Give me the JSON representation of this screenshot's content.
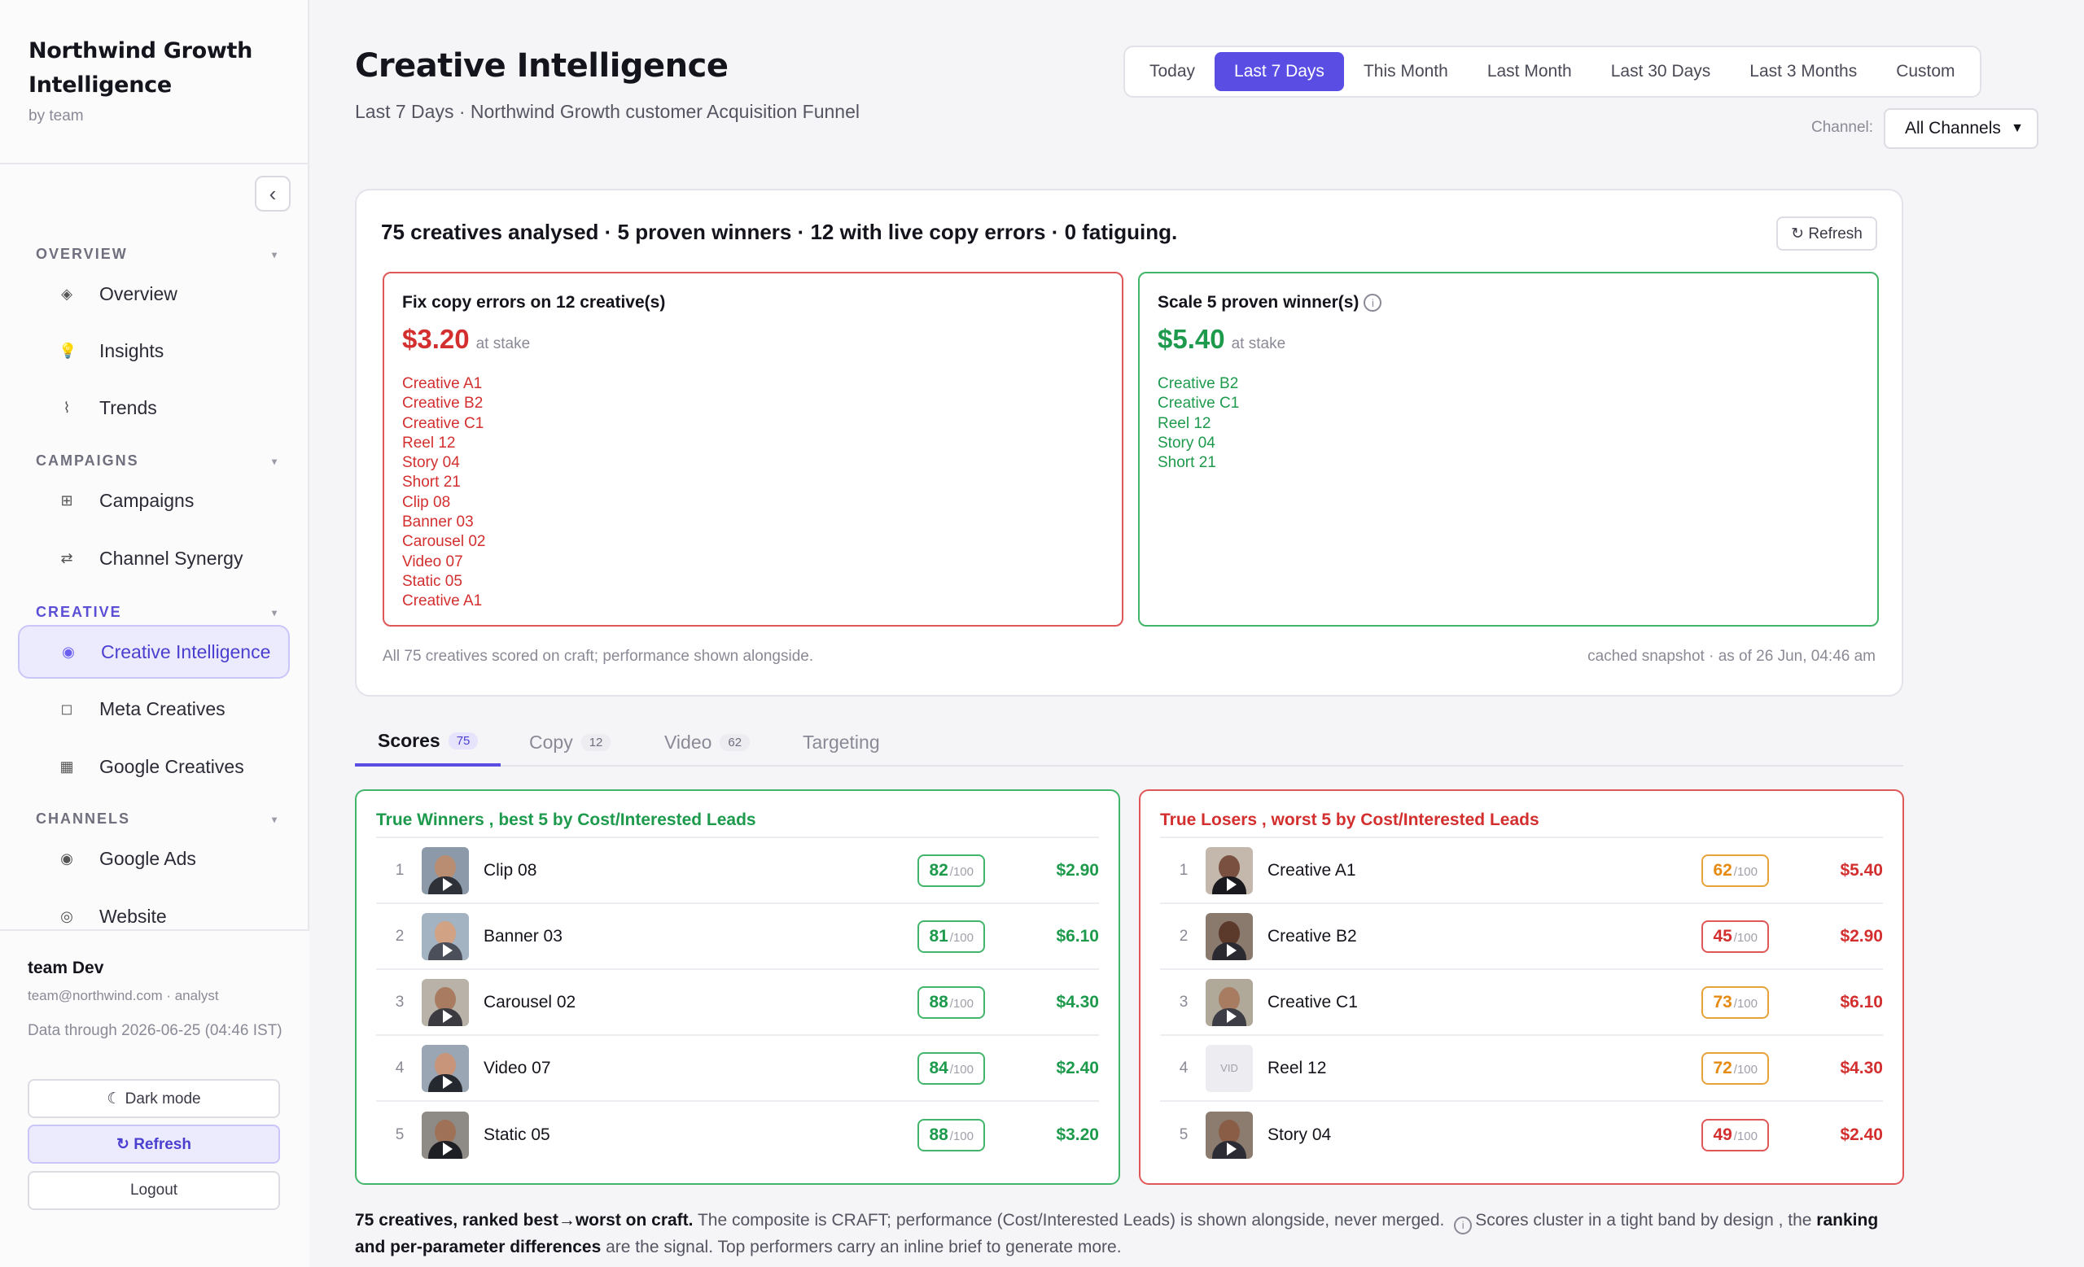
{
  "brand": {
    "title": "Northwind Growth Intelligence",
    "subtitle": "by team"
  },
  "sidebar": {
    "sections": [
      {
        "label": "OVERVIEW"
      },
      {
        "label": "CAMPAIGNS"
      },
      {
        "label": "CREATIVE"
      },
      {
        "label": "CHANNELS"
      }
    ],
    "items": [
      {
        "label": "Overview",
        "icon": "◈"
      },
      {
        "label": "Insights",
        "icon": "💡"
      },
      {
        "label": "Trends",
        "icon": "⌇"
      },
      {
        "label": "Campaigns",
        "icon": "⊞"
      },
      {
        "label": "Channel Synergy",
        "icon": "⇄"
      },
      {
        "label": "Creative Intelligence",
        "icon": "◉"
      },
      {
        "label": "Meta Creatives",
        "icon": "◻"
      },
      {
        "label": "Google Creatives",
        "icon": "▦"
      },
      {
        "label": "Google Ads",
        "icon": "◉"
      },
      {
        "label": "Website",
        "icon": "◎"
      }
    ],
    "active_item": "Creative Intelligence"
  },
  "user": {
    "name": "team Dev",
    "email": "team@northwind.com · analyst",
    "data_through": "Data through 2026-06-25 (04:46 IST)",
    "dark_mode": "☾ Dark mode",
    "refresh": "↻ Refresh",
    "logout": "Logout"
  },
  "header": {
    "title": "Creative Intelligence",
    "subtitle": "Last 7 Days · Northwind Growth customer Acquisition Funnel",
    "ranges": [
      "Today",
      "Last 7 Days",
      "This Month",
      "Last Month",
      "Last 30 Days",
      "Last 3 Months",
      "Custom"
    ],
    "active_range": "Last 7 Days",
    "channel_label": "Channel:",
    "channel_value": "All Channels"
  },
  "summary": {
    "headline": "75 creatives analysed · 5 proven winners · 12 with live copy errors · 0 fatiguing.",
    "refresh": "↻ Refresh",
    "fix": {
      "title": "Fix copy errors on 12 creative(s)",
      "amount": "$3.20",
      "stake": "at stake",
      "items": [
        "Creative A1",
        "Creative B2",
        "Creative C1",
        "Reel 12",
        "Story 04",
        "Short 21",
        "Clip 08",
        "Banner 03",
        "Carousel 02",
        "Video 07",
        "Static 05",
        "Creative A1"
      ]
    },
    "scale": {
      "title": "Scale 5 proven winner(s)",
      "amount": "$5.40",
      "stake": "at stake",
      "items": [
        "Creative B2",
        "Creative C1",
        "Reel 12",
        "Story 04",
        "Short 21"
      ]
    },
    "footer_left": "All 75 creatives scored on craft; performance shown alongside.",
    "footer_right": "cached snapshot · as of 26 Jun, 04:46 am"
  },
  "tabs": [
    {
      "label": "Scores",
      "count": "75"
    },
    {
      "label": "Copy",
      "count": "12"
    },
    {
      "label": "Video",
      "count": "62"
    },
    {
      "label": "Targeting",
      "count": ""
    }
  ],
  "winners": {
    "title": "True Winners , best 5 by Cost/Interested Leads",
    "rows": [
      {
        "rank": "1",
        "name": "Clip 08",
        "score": "82",
        "denom": "/100",
        "cost": "$2.90",
        "tone": "green"
      },
      {
        "rank": "2",
        "name": "Banner 03",
        "score": "81",
        "denom": "/100",
        "cost": "$6.10",
        "tone": "green"
      },
      {
        "rank": "3",
        "name": "Carousel 02",
        "score": "88",
        "denom": "/100",
        "cost": "$4.30",
        "tone": "green"
      },
      {
        "rank": "4",
        "name": "Video 07",
        "score": "84",
        "denom": "/100",
        "cost": "$2.40",
        "tone": "green"
      },
      {
        "rank": "5",
        "name": "Static 05",
        "score": "88",
        "denom": "/100",
        "cost": "$3.20",
        "tone": "green"
      }
    ]
  },
  "losers": {
    "title": "True Losers , worst 5 by Cost/Interested Leads",
    "rows": [
      {
        "rank": "1",
        "name": "Creative A1",
        "score": "62",
        "denom": "/100",
        "cost": "$5.40",
        "tone": "amber"
      },
      {
        "rank": "2",
        "name": "Creative B2",
        "score": "45",
        "denom": "/100",
        "cost": "$2.90",
        "tone": "red"
      },
      {
        "rank": "3",
        "name": "Creative C1",
        "score": "73",
        "denom": "/100",
        "cost": "$6.10",
        "tone": "amber"
      },
      {
        "rank": "4",
        "name": "Reel 12",
        "score": "72",
        "denom": "/100",
        "cost": "$4.30",
        "tone": "amber",
        "thumb_text": "VID"
      },
      {
        "rank": "5",
        "name": "Story 04",
        "score": "49",
        "denom": "/100",
        "cost": "$2.40",
        "tone": "red"
      }
    ]
  },
  "explain": {
    "b1": "75 creatives, ranked best→worst on craft.",
    "t1": " The composite is CRAFT; performance (Cost/Interested Leads) is shown alongside, never merged. ",
    "t2": "Scores cluster in a tight band by design , the ",
    "b2": "ranking and per-parameter differences",
    "t3": " are the signal. Top performers carry an inline brief to generate more."
  },
  "colors": {
    "accent": "#5a4de4",
    "win": "#1e9a4d",
    "lose": "#d32f2f",
    "amber": "#e58b13"
  }
}
